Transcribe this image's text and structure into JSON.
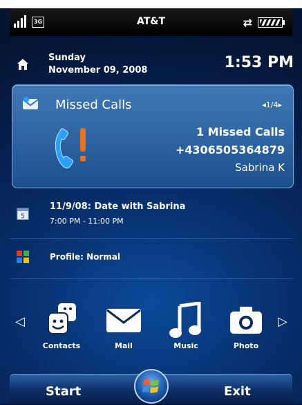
{
  "status_bar": {
    "carrier": "AT&T",
    "network_badge": "3G",
    "signal_icon": "signal-icon",
    "sync_icon": "sync-icon",
    "battery_icon": "battery-icon"
  },
  "home": {
    "day": "Sunday",
    "date": "November 09, 2008",
    "time": "1:53 PM"
  },
  "missed_calls": {
    "title": "Missed Calls",
    "pager": "◂1/4▸",
    "count_text": "1 Missed Calls",
    "number": "+4306505364879",
    "name": "Sabrina K"
  },
  "appointment": {
    "title": "11/9/08: Date with Sabrina",
    "time": "7:00 PM - 11:00 PM"
  },
  "profile": {
    "text": "Profile: Normal"
  },
  "apps": [
    {
      "label": "Contacts",
      "icon": "contacts-icon"
    },
    {
      "label": "Mail",
      "icon": "mail-icon"
    },
    {
      "label": "Music",
      "icon": "music-icon"
    },
    {
      "label": "Photo",
      "icon": "camera-icon"
    }
  ],
  "softkeys": {
    "left": "Start",
    "right": "Exit"
  },
  "colors": {
    "background": "#062a63",
    "panel": "#2e65a3",
    "missed_exclamation": "#e8731e",
    "phone": "#2aa0ff"
  }
}
